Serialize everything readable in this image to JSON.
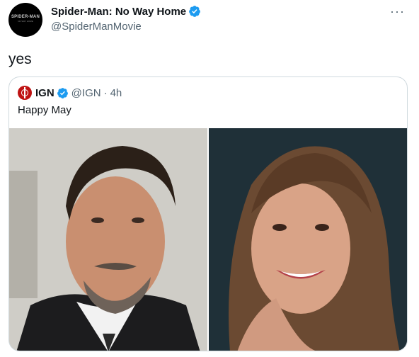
{
  "author": {
    "name": "Spider-Man: No Way Home",
    "handle": "@SpiderManMovie",
    "avatar_text": "SPIDER-MAN",
    "avatar_subtext": "NO WAY HOME"
  },
  "tweet": {
    "text": "yes",
    "more_icon": "more-horizontal-icon"
  },
  "quoted": {
    "name": "IGN",
    "handle": "@IGN",
    "separator": "·",
    "time": "4h",
    "text": "Happy May"
  },
  "colors": {
    "verified": "#1d9bf0",
    "ign_red": "#bf1313",
    "muted": "#536471"
  }
}
